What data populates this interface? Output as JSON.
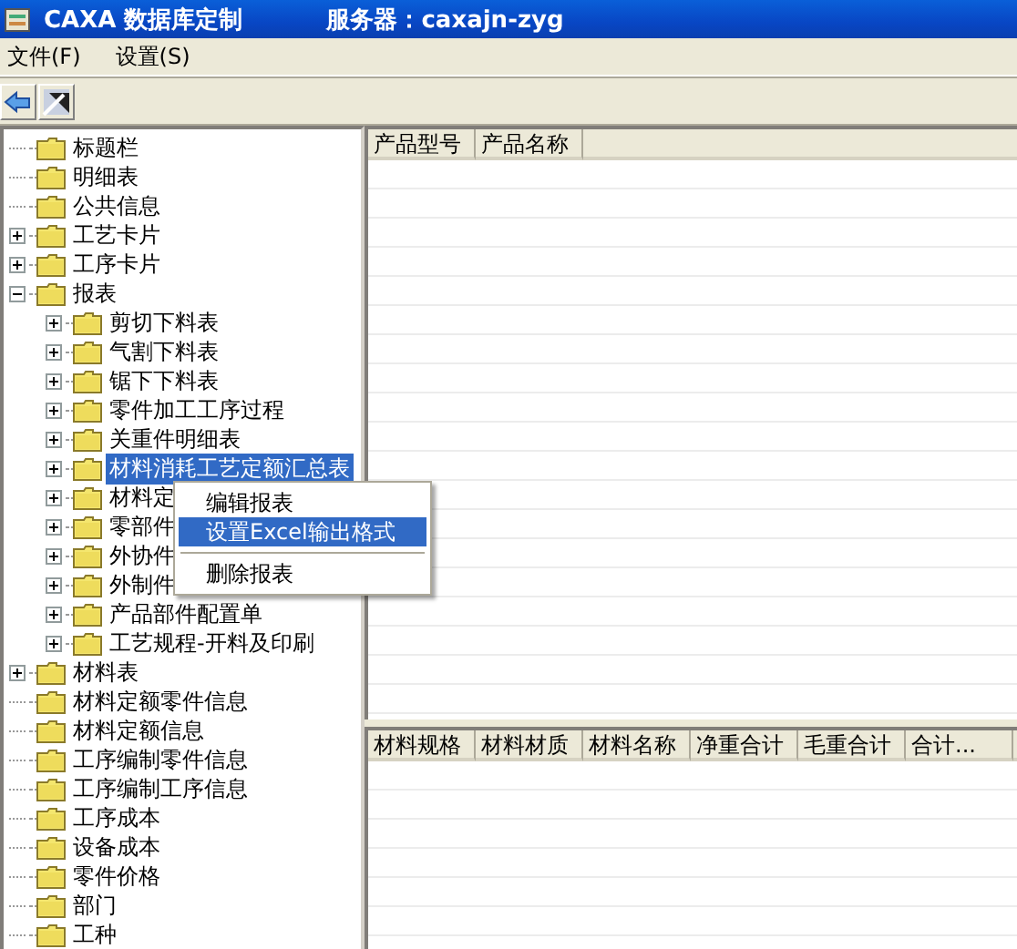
{
  "window": {
    "title": "CAXA 数据库定制",
    "server": "服务器：caxajn-zyg"
  },
  "menu": [
    "文件(F)",
    "设置(S)"
  ],
  "tree": [
    {
      "label": "标题栏",
      "selected": false
    },
    {
      "label": "明细表",
      "selected": false
    },
    {
      "label": "公共信息",
      "selected": false
    },
    {
      "label": "工艺卡片",
      "expanded": false,
      "selected": false
    },
    {
      "label": "工序卡片",
      "expanded": false,
      "selected": false
    },
    {
      "label": "报表",
      "expanded": true,
      "selected": false,
      "children": [
        {
          "label": "剪切下料表",
          "expanded": false,
          "selected": false
        },
        {
          "label": "气割下料表",
          "expanded": false,
          "selected": false
        },
        {
          "label": "锯下下料表",
          "expanded": false,
          "selected": false
        },
        {
          "label": "零件加工工序过程",
          "expanded": false,
          "selected": false
        },
        {
          "label": "关重件明细表",
          "expanded": false,
          "selected": false
        },
        {
          "label": "材料消耗工艺定额汇总表",
          "expanded": false,
          "selected": true
        },
        {
          "label": "材料定",
          "expanded": false,
          "selected": false
        },
        {
          "label": "零部件",
          "expanded": false,
          "selected": false
        },
        {
          "label": "外协件",
          "expanded": false,
          "selected": false
        },
        {
          "label": "外制件",
          "expanded": false,
          "selected": false
        },
        {
          "label": "产品部件配置单",
          "expanded": false,
          "selected": false
        },
        {
          "label": "工艺规程-开料及印刷",
          "expanded": false,
          "selected": false
        }
      ]
    },
    {
      "label": "材料表",
      "expanded": false,
      "selected": false
    },
    {
      "label": "材料定额零件信息",
      "selected": false
    },
    {
      "label": "材料定额信息",
      "selected": false
    },
    {
      "label": "工序编制零件信息",
      "selected": false
    },
    {
      "label": "工序编制工序信息",
      "selected": false
    },
    {
      "label": "工序成本",
      "selected": false
    },
    {
      "label": "设备成本",
      "selected": false
    },
    {
      "label": "零件价格",
      "selected": false
    },
    {
      "label": "部门",
      "selected": false
    },
    {
      "label": "工种",
      "selected": false
    }
  ],
  "product_table": {
    "columns": [
      "产品型号",
      "产品名称"
    ]
  },
  "material_table": {
    "columns": [
      "材料规格",
      "材料材质",
      "材料名称",
      "净重合计",
      "毛重合计",
      "合计..."
    ]
  },
  "context_menu": [
    {
      "kind": "item",
      "label": "编辑报表",
      "selected": false
    },
    {
      "kind": "item",
      "label": "设置Excel输出格式",
      "selected": true
    },
    {
      "kind": "separator"
    },
    {
      "kind": "item",
      "label": "删除报表",
      "selected": false
    }
  ]
}
